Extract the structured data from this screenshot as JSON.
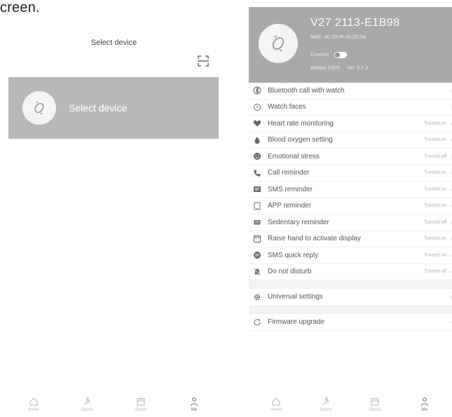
{
  "caption": "creen.",
  "left": {
    "title": "Select device",
    "device_card_label": "Select device",
    "tabs": [
      {
        "label": "Home",
        "icon": "home-icon"
      },
      {
        "label": "Sports",
        "icon": "sports-icon"
      },
      {
        "label": "Status",
        "icon": "calendar-icon"
      },
      {
        "label": "Me",
        "icon": "person-icon"
      }
    ]
  },
  "right": {
    "device": {
      "name": "V27 2113-E1B98",
      "mac": "MAC: 4C:29:0F:40:2D:5B",
      "connection_label": "Connect",
      "battery_label": "Battery 100%",
      "firmware": "Ver: 0.7.3"
    },
    "settings": [
      {
        "label": "Bluetooth call with watch",
        "status": "",
        "icon": "bluetooth-icon"
      },
      {
        "label": "Watch faces",
        "status": "",
        "icon": "watch-icon"
      },
      {
        "label": "Heart rate monitoring",
        "status": "Turned on",
        "icon": "heart-icon"
      },
      {
        "label": "Blood oxygen setting",
        "status": "Turned on",
        "icon": "drop-icon"
      },
      {
        "label": "Emotional stress",
        "status": "Turned off",
        "icon": "emotion-icon"
      },
      {
        "label": "Call reminder",
        "status": "Turned on",
        "icon": "phone-icon"
      },
      {
        "label": "SMS reminder",
        "status": "Turned on",
        "icon": "sms-icon"
      },
      {
        "label": "APP reminder",
        "status": "Turned on",
        "icon": "app-icon"
      },
      {
        "label": "Sedentary reminder",
        "status": "Turned off",
        "icon": "sedentary-icon"
      },
      {
        "label": "Raise hand to activate display",
        "status": "Turned on",
        "icon": "raise-hand-icon"
      },
      {
        "label": "SMS quick reply",
        "status": "Turned on",
        "icon": "quick-reply-icon"
      },
      {
        "label": "Do not disturb",
        "status": "Turned off",
        "icon": "dnd-icon"
      }
    ],
    "general_settings_label": "Universal settings",
    "firmware_upgrade_label": "Firmware upgrade",
    "tabs": [
      {
        "label": "Home",
        "icon": "home-icon"
      },
      {
        "label": "Sports",
        "icon": "sports-icon"
      },
      {
        "label": "Status",
        "icon": "calendar-icon"
      },
      {
        "label": "Me",
        "icon": "person-icon"
      }
    ]
  }
}
